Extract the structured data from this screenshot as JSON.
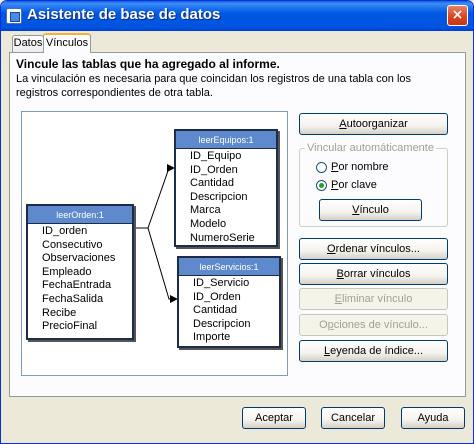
{
  "window": {
    "title": "Asistente de base de datos",
    "close_glyph": "×"
  },
  "tabs": [
    {
      "label": "Datos",
      "active": false
    },
    {
      "label": "Vínculos",
      "active": true
    }
  ],
  "panel": {
    "heading": "Vincule las tablas que ha agregado al informe.",
    "description": "La vinculación es necesaria para que coincidan los registros de una tabla con los registros correspondientes de otra tabla."
  },
  "tables": [
    {
      "title": "leerOrden:1",
      "fields": [
        "ID_orden",
        "Consecutivo",
        "Observaciones",
        "Empleado",
        "FechaEntrada",
        "FechaSalida",
        "Recibe",
        "PrecioFinal"
      ]
    },
    {
      "title": "leerEquipos:1",
      "fields": [
        "ID_Equipo",
        "ID_Orden",
        "Cantidad",
        "Descripcion",
        "Marca",
        "Modelo",
        "NumeroSerie"
      ]
    },
    {
      "title": "leerServicios:1",
      "fields": [
        "ID_Servicio",
        "ID_Orden",
        "Cantidad",
        "Descripcion",
        "Importe"
      ]
    }
  ],
  "side": {
    "autoorganizar": {
      "pre": "",
      "key": "A",
      "post": "utoorganizar"
    },
    "group_title": "Vincular automáticamente",
    "radio_nombre": {
      "pre": "",
      "key": "P",
      "post": "or nombre",
      "selected": false
    },
    "radio_clave": {
      "pre": "",
      "key": "P",
      "post": "or clave",
      "selected": true
    },
    "vinculo": {
      "pre": "",
      "key": "V",
      "post": "ínculo"
    },
    "ordenar": {
      "pre": "",
      "key": "O",
      "post": "rdenar vínculos..."
    },
    "borrar": {
      "pre": "",
      "key": "B",
      "post": "orrar vínculos"
    },
    "eliminar": {
      "pre": "",
      "key": "E",
      "post": "liminar vínculo"
    },
    "opciones": {
      "pre": "O",
      "key": "p",
      "post": "ciones de vínculo..."
    },
    "leyenda": {
      "pre": "",
      "key": "L",
      "post": "eyenda de índice..."
    }
  },
  "footer": {
    "aceptar": "Aceptar",
    "cancelar": "Cancelar",
    "ayuda": "Ayuda"
  },
  "colors": {
    "title_bar": "#0054e0",
    "table_header": "#5e8acd",
    "disabled_text": "#a1a192",
    "active_tab_accent": "#f8b030"
  }
}
